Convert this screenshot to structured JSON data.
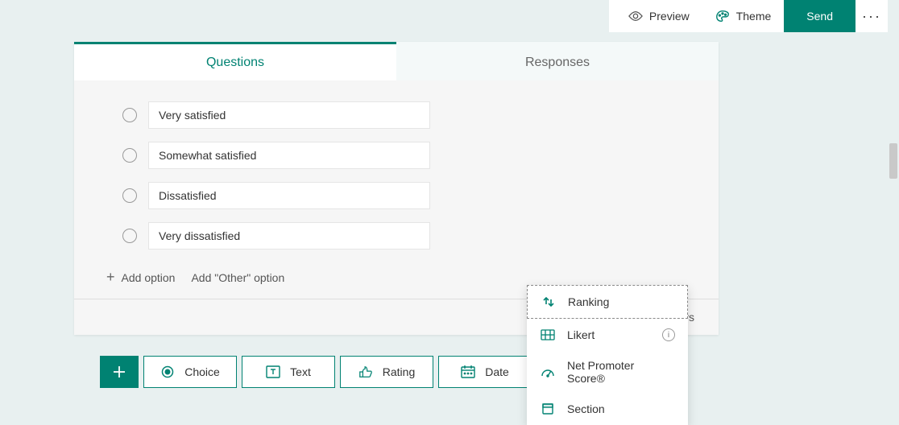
{
  "header": {
    "preview": "Preview",
    "theme": "Theme",
    "send": "Send"
  },
  "tabs": {
    "questions": "Questions",
    "responses": "Responses"
  },
  "question": {
    "options": [
      "Very satisfied",
      "Somewhat satisfied",
      "Dissatisfied",
      "Very dissatisfied"
    ],
    "add_option": "Add option",
    "add_other": "Add \"Other\" option",
    "multiple_answers": "Multiple answers"
  },
  "add_types": {
    "choice": "Choice",
    "text": "Text",
    "rating": "Rating",
    "date": "Date"
  },
  "popup": {
    "ranking": "Ranking",
    "likert": "Likert",
    "nps": "Net Promoter Score®",
    "section": "Section"
  },
  "colors": {
    "accent": "#008272"
  }
}
